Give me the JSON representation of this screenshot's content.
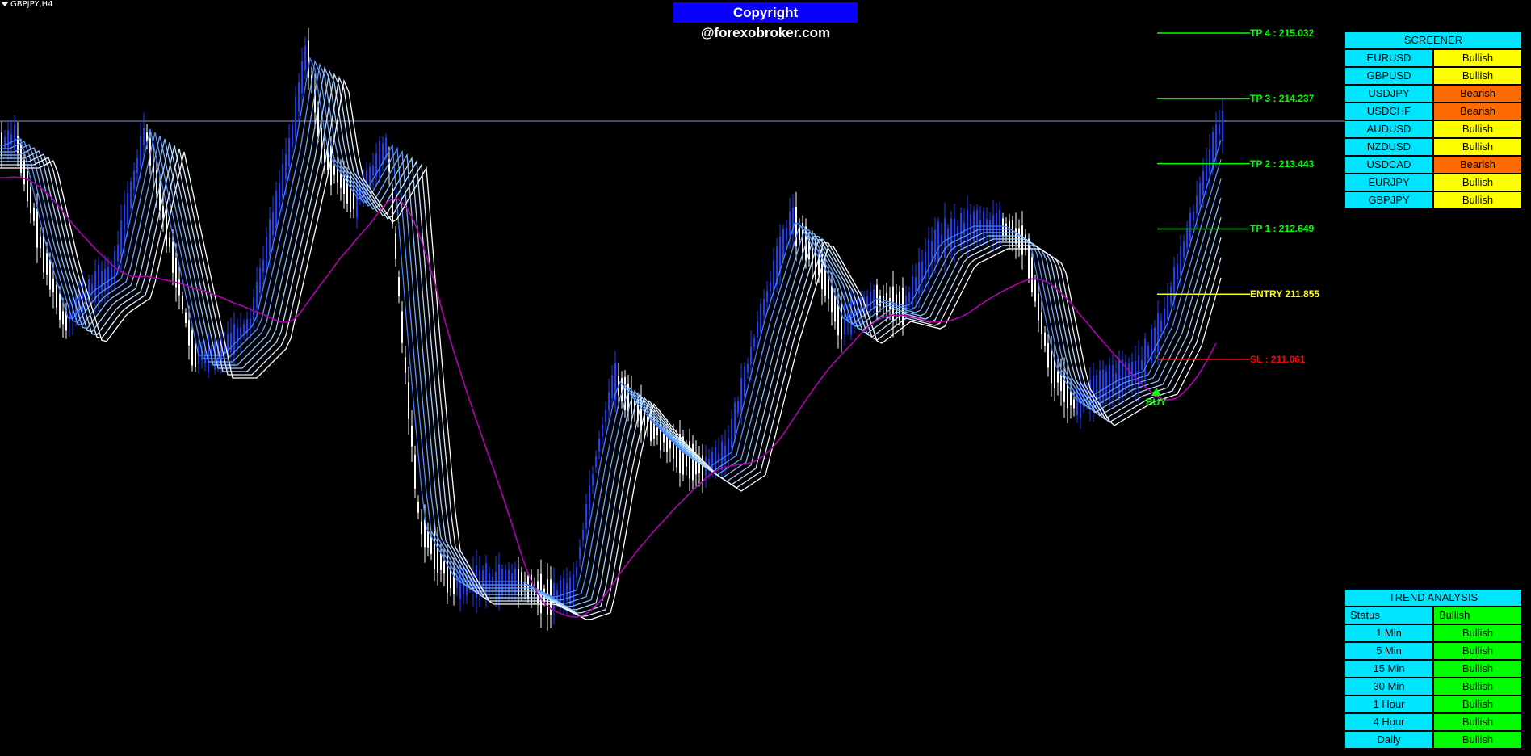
{
  "chart": {
    "symbol_label": "GBPJPY,H4",
    "copyright": "Copyright @forexobroker.com",
    "buy_label": "BUY"
  },
  "levels": [
    {
      "label": "TP 4 : 215.032",
      "price": 215.032,
      "color": "#00ff00"
    },
    {
      "label": "TP 3 : 214.237",
      "price": 214.237,
      "color": "#00ff00"
    },
    {
      "label": "TP 2 : 213.443",
      "price": 213.443,
      "color": "#00ff00"
    },
    {
      "label": "TP 1 : 212.649",
      "price": 212.649,
      "color": "#00ff00"
    },
    {
      "label": "ENTRY 211.855",
      "price": 211.855,
      "color": "#ffff00"
    },
    {
      "label": "SL : 211.061",
      "price": 211.061,
      "color": "#ff0000"
    }
  ],
  "screener": {
    "title": "SCREENER",
    "rows": [
      {
        "pair": "EURUSD",
        "status": "Bullish"
      },
      {
        "pair": "GBPUSD",
        "status": "Bullish"
      },
      {
        "pair": "USDJPY",
        "status": "Bearish"
      },
      {
        "pair": "USDCHF",
        "status": "Bearish"
      },
      {
        "pair": "AUDUSD",
        "status": "Bullish"
      },
      {
        "pair": "NZDUSD",
        "status": "Bullish"
      },
      {
        "pair": "USDCAD",
        "status": "Bearish"
      },
      {
        "pair": "EURJPY",
        "status": "Bullish"
      },
      {
        "pair": "GBPJPY",
        "status": "Bullish"
      }
    ]
  },
  "trend": {
    "title": "TREND ANALYSIS",
    "status_label": "Status",
    "status_value": "Bullish",
    "rows": [
      {
        "tf": "1 Min",
        "status": "Bullish"
      },
      {
        "tf": "5 Min",
        "status": "Bullish"
      },
      {
        "tf": "15 Min",
        "status": "Bullish"
      },
      {
        "tf": "30 Min",
        "status": "Bullish"
      },
      {
        "tf": "1 Hour",
        "status": "Bullish"
      },
      {
        "tf": "4 Hour",
        "status": "Bullish"
      },
      {
        "tf": "Daily",
        "status": "Bullish"
      }
    ]
  },
  "colors": {
    "background": "#000000",
    "bull_candle": "#1f3dff",
    "bear_candle": "#ffffff",
    "ma_trend": "#b000b0",
    "ribbon_bull": "#4aa8ff",
    "ribbon_bear": "#9a9a9a",
    "panel_cyan": "#00e5ff",
    "bullish": "#ffff00",
    "bearish": "#ff6a00",
    "trend_green": "#00ff00"
  }
}
